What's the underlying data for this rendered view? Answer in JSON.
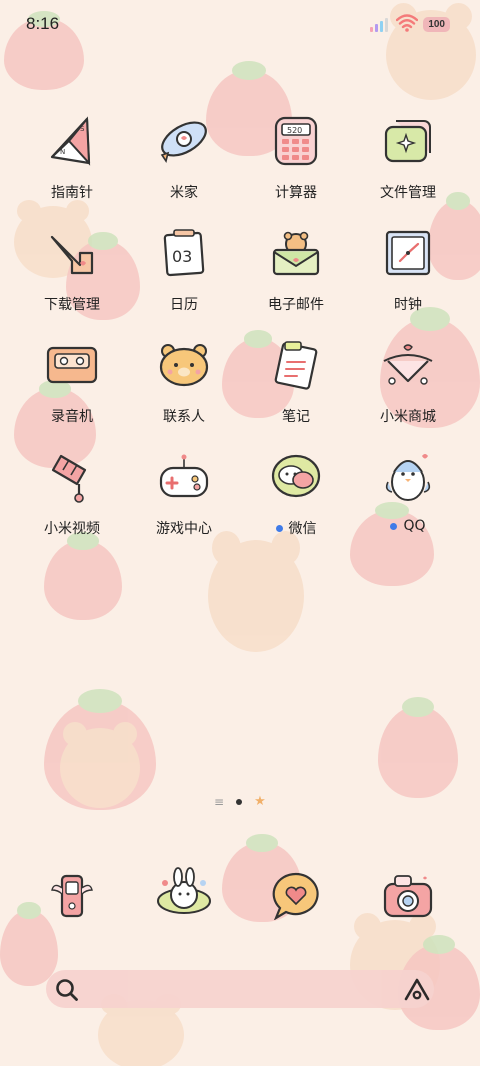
{
  "status_bar": {
    "time": "8:16",
    "battery": "100",
    "signal_colors": [
      "#f6a3b5",
      "#b49af0",
      "#8fd1f2",
      "#d8d8d8"
    ],
    "wifi_color": "#f47a7a"
  },
  "apps": [
    {
      "label": "指南针",
      "icon": "compass-icon"
    },
    {
      "label": "米家",
      "icon": "mijia-rocket-icon"
    },
    {
      "label": "计算器",
      "icon": "calculator-icon",
      "display": "520"
    },
    {
      "label": "文件管理",
      "icon": "folder-icon"
    },
    {
      "label": "下载管理",
      "icon": "download-icon"
    },
    {
      "label": "日历",
      "icon": "calendar-icon",
      "date": "03"
    },
    {
      "label": "电子邮件",
      "icon": "email-icon"
    },
    {
      "label": "时钟",
      "icon": "clock-icon"
    },
    {
      "label": "录音机",
      "icon": "recorder-icon"
    },
    {
      "label": "联系人",
      "icon": "contacts-bear-icon"
    },
    {
      "label": "笔记",
      "icon": "notes-icon"
    },
    {
      "label": "小米商城",
      "icon": "mi-store-icon"
    },
    {
      "label": "小米视频",
      "icon": "video-icon"
    },
    {
      "label": "游戏中心",
      "icon": "game-center-icon"
    },
    {
      "label": "微信",
      "icon": "wechat-icon",
      "badge": true
    },
    {
      "label": "QQ",
      "icon": "qq-penguin-icon",
      "badge": true
    }
  ],
  "dock": [
    {
      "icon": "phone-icon"
    },
    {
      "icon": "camera-rabbit-icon"
    },
    {
      "icon": "messages-heart-icon"
    },
    {
      "icon": "camera-icon"
    }
  ],
  "colors": {
    "background": "#fbefe6",
    "badge_dot": "#3f7be8",
    "search_bar": "#f7d3cf"
  }
}
